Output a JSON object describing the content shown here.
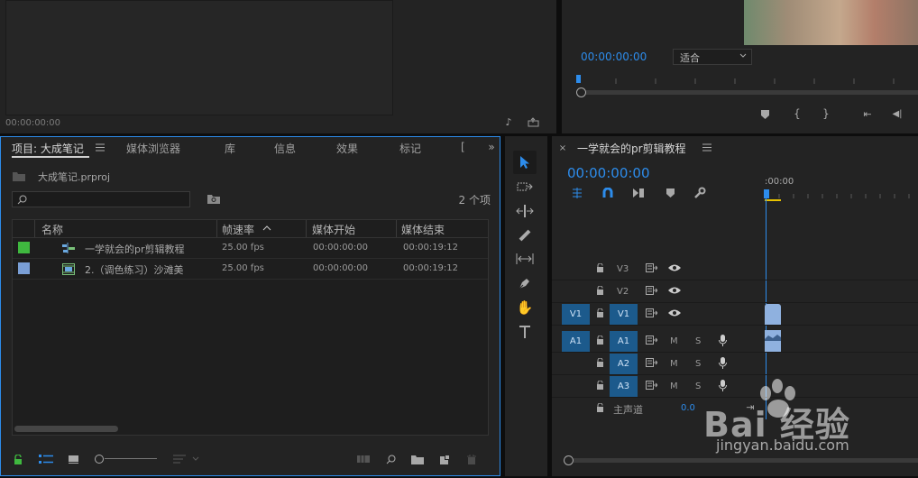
{
  "source_monitor": {
    "timecode": "00:00:00:00"
  },
  "program_monitor": {
    "timecode": "00:00:00:00",
    "fit_option": "适合"
  },
  "project_panel": {
    "tabs": [
      "项目: 大成笔记",
      "媒体浏览器",
      "库",
      "信息",
      "效果",
      "标记",
      "["
    ],
    "project_file": "大成笔记.prproj",
    "item_count": "2 个项",
    "columns": [
      "名称",
      "帧速率",
      "媒体开始",
      "媒体结束"
    ],
    "rows": [
      {
        "color": "#3fb83f",
        "name": "一学就会的pr剪辑教程",
        "fps": "25.00 fps",
        "start": "00:00:00:00",
        "end": "00:00:19:12"
      },
      {
        "color": "#7a9fd6",
        "name": "2.（调色练习）沙滩美",
        "fps": "25.00 fps",
        "start": "00:00:00:00",
        "end": "00:00:19:12"
      }
    ]
  },
  "timeline": {
    "sequence_name": "一学就会的pr剪辑教程",
    "timecode": "00:00:00:00",
    "ruler_label": ":00:00",
    "tracks": {
      "v3": "V3",
      "v2": "V2",
      "v1": "V1",
      "v1_src": "V1",
      "a1": "A1",
      "a1_src": "A1",
      "a2": "A2",
      "a3": "A3",
      "m": "M",
      "s": "S",
      "master": "主声道",
      "master_value": "0.0"
    }
  },
  "watermark": {
    "brand": "Bai 经验",
    "url": "jingyan.baidu.com"
  }
}
